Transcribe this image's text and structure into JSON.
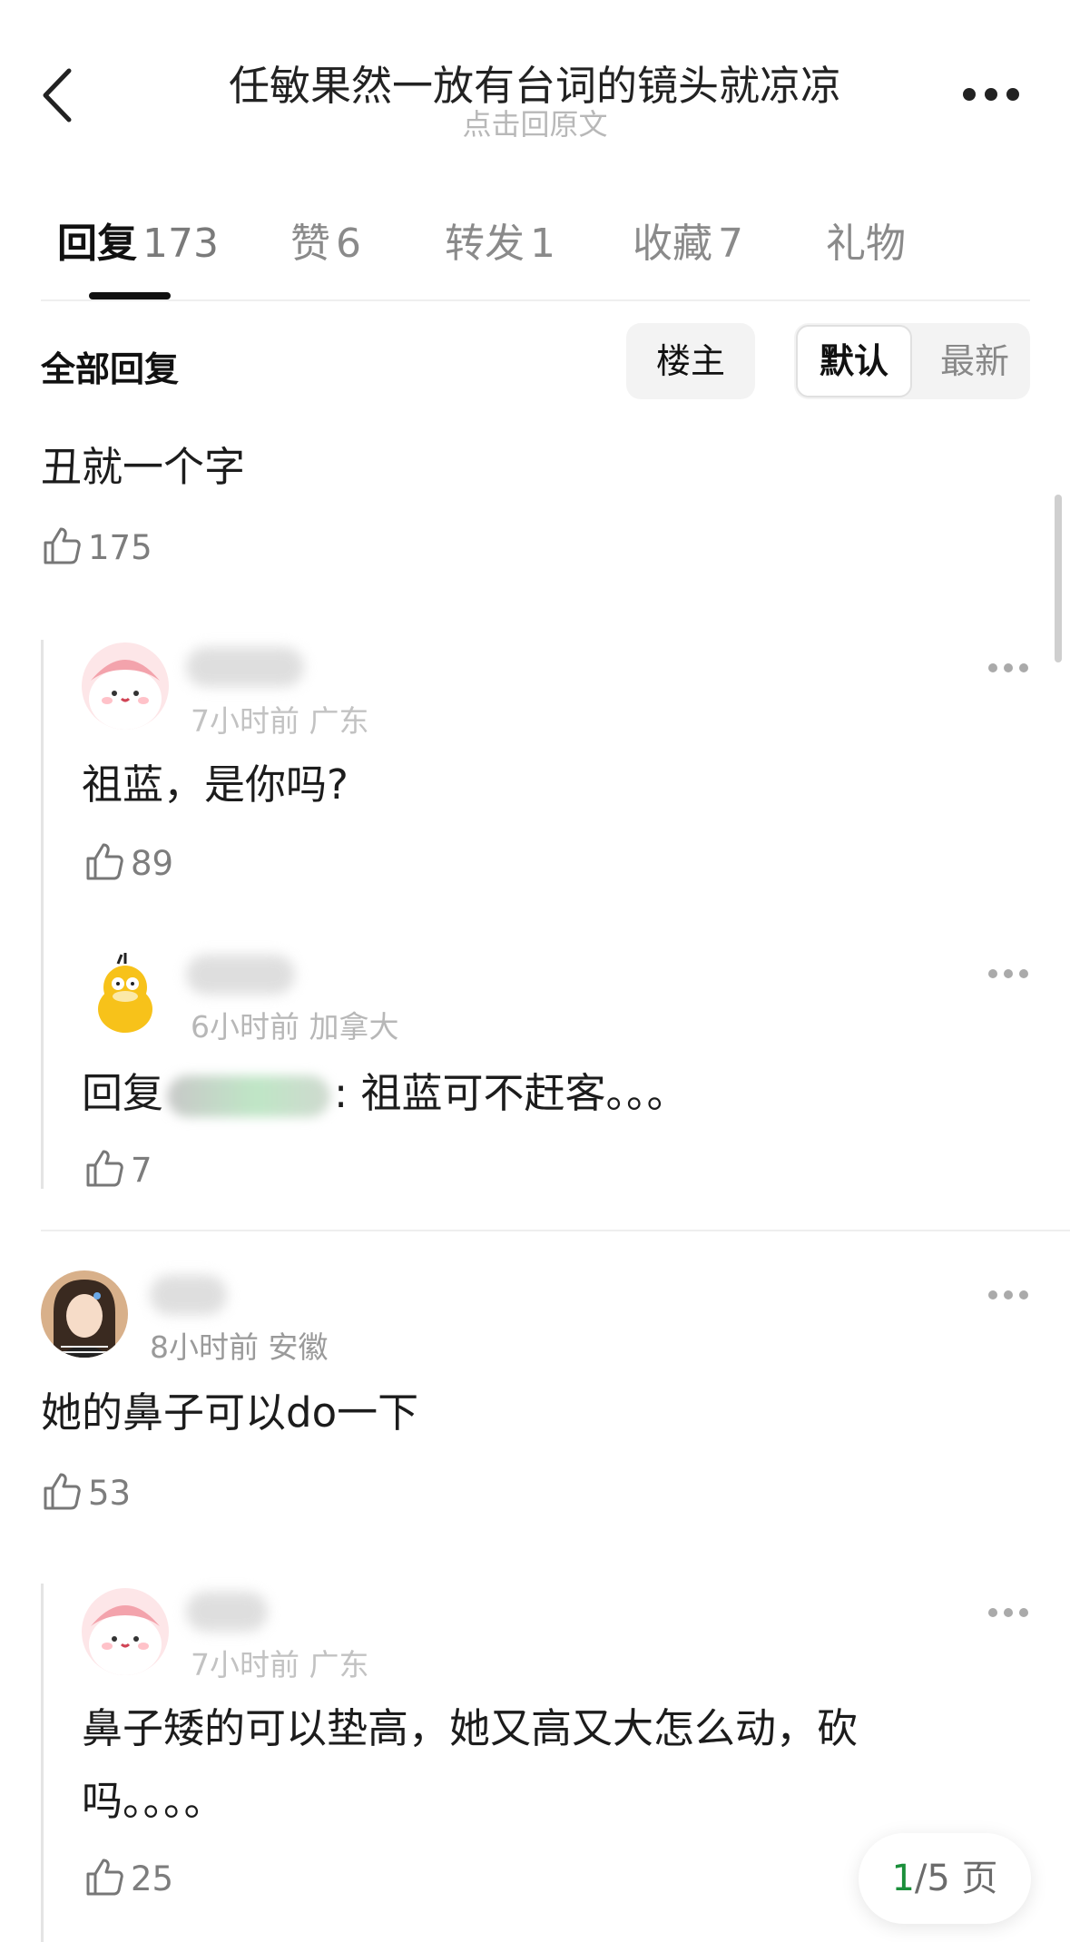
{
  "header": {
    "title": "任敏果然一放有台词的镜头就凉凉",
    "subtitle": "点击回原文"
  },
  "tabs": [
    {
      "label": "回复",
      "count": "173",
      "active": true
    },
    {
      "label": "赞",
      "count": "6"
    },
    {
      "label": "转发",
      "count": "1"
    },
    {
      "label": "收藏",
      "count": "7"
    },
    {
      "label": "礼物",
      "count": ""
    }
  ],
  "filter": {
    "all_replies": "全部回复",
    "op_only": "楼主",
    "sort_default": "默认",
    "sort_newest": "最新"
  },
  "comments": [
    {
      "text": "丑就一个字",
      "likes": "175",
      "replies": [
        {
          "meta": "7小时前 广东",
          "text": "祖蓝，是你吗?",
          "likes": "89"
        },
        {
          "meta": "6小时前 加拿大",
          "reply_prefix": "回复",
          "text": ": 祖蓝可不赶客。。。",
          "likes": "7"
        }
      ]
    },
    {
      "meta": "8小时前 安徽",
      "text": "她的鼻子可以do一下",
      "likes": "53",
      "replies": [
        {
          "meta": "7小时前 广东",
          "text_line1": "鼻子矮的可以垫高，她又高又大怎么动，砍",
          "text_line2": "吗。。。。",
          "likes": "25"
        }
      ]
    }
  ],
  "pager": {
    "current": "1",
    "total": "/5 页"
  },
  "colors": {
    "accent_green": "#1a8f3a",
    "muted": "#9a9a9a"
  }
}
